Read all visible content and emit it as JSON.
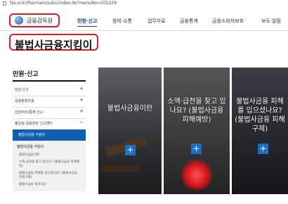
{
  "browser": {
    "url": "fss.or.kr/fss/main/sub1/index.do?menuNo=201229"
  },
  "header": {
    "logo_text": "금융감독원",
    "nav": [
      "민원·신고",
      "참여·소통",
      "업무자료",
      "금융통계",
      "금융소비자보호",
      "보도·알림"
    ]
  },
  "page_title": "불법사금융지킴이",
  "sidebar": {
    "title": "민원·신고",
    "items": [
      {
        "label": "민원·신고"
      },
      {
        "label": "금융분쟁조정"
      },
      {
        "label": "민원처리/통계·신고"
      },
      {
        "label": "불공정·금융관련 신고센터"
      }
    ],
    "active": "불법사금융 지킴이",
    "submenu_head": "불법사금융 지킴이",
    "subitems": [
      "불법사금융이란",
      "소액·급전을 찾고 있나요? (불법사금융 피해예방)",
      "불법사금융 피해를 입으셨나요? (불법사금융 피해구제)",
      "불법사금융 정보모음"
    ]
  },
  "cards": [
    {
      "label": "불법사금융이란"
    },
    {
      "label": "소액·급전을 찾고 있나요? (불법사금융 피해예방)"
    },
    {
      "label": "불법사금융 피해를 입으셨나요? (불법사금융 피해구제)"
    }
  ],
  "colors": {
    "accent": "#d4202c",
    "primary": "#0e5fae",
    "nav_active": "#123e73"
  }
}
